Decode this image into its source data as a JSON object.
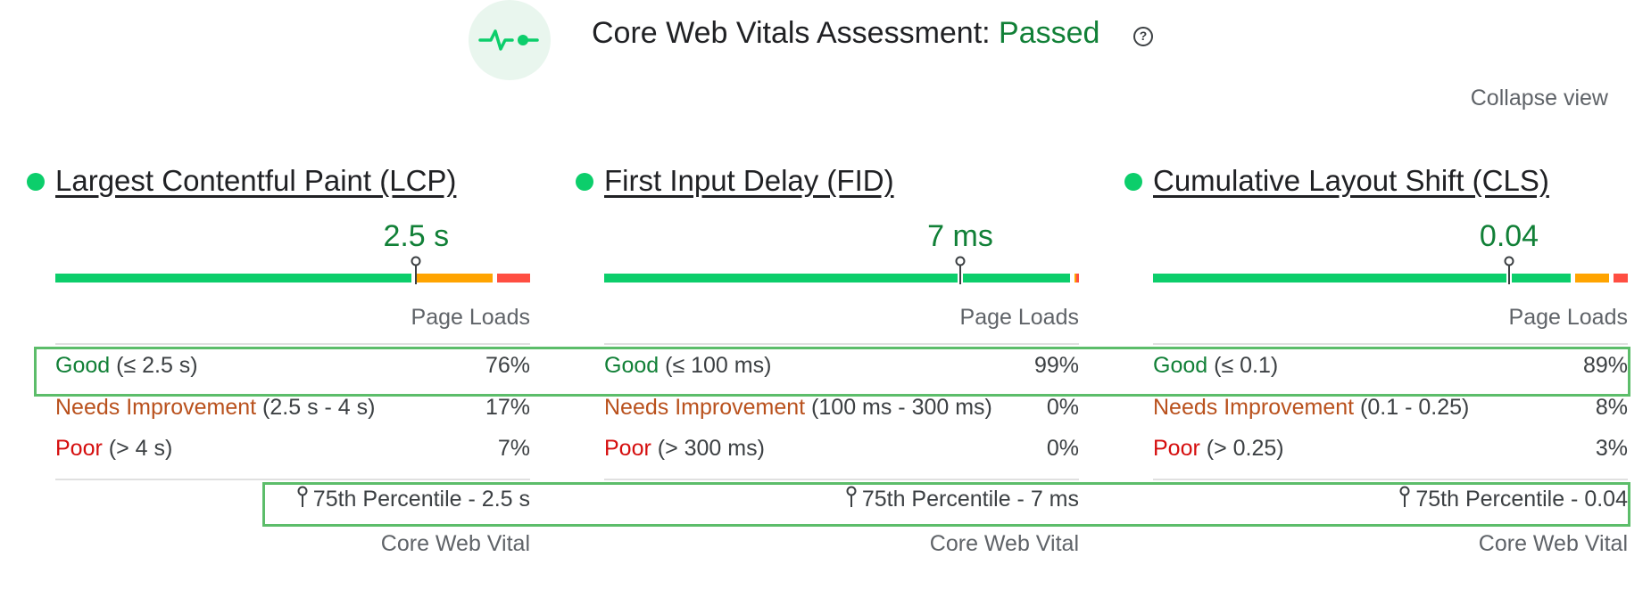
{
  "header": {
    "title_prefix": "Core Web Vitals Assessment: ",
    "status": "Passed",
    "icon": "vitals-pulse-icon",
    "help_icon": "help-circle-icon",
    "help_glyph": "?"
  },
  "collapse_label": "Collapse view",
  "colors": {
    "good": "#0cce6b",
    "good_text": "#118037",
    "needs_improvement": "#ffa400",
    "needs_improvement_text": "#b9511d",
    "poor": "#ff4e42",
    "poor_text": "#d50e0e",
    "highlight_border": "#5cbd6a"
  },
  "metrics": [
    {
      "name": "Largest Contentful Paint (LCP)",
      "p75_value": "2.5 s",
      "page_loads_label": "Page Loads",
      "distribution": {
        "good": 0.76,
        "needs_improvement": 0.17,
        "poor": 0.07
      },
      "p75_position": 0.76,
      "rows": [
        {
          "label": "Good",
          "range": " (≤ 2.5 s)",
          "pct": "76%"
        },
        {
          "label": "Needs Improvement",
          "range": " (2.5 s - 4 s)",
          "pct": "17%"
        },
        {
          "label": "Poor",
          "range": " (> 4 s)",
          "pct": "7%"
        }
      ],
      "p75_label": "75th Percentile - 2.5 s",
      "footer": "Core Web Vital"
    },
    {
      "name": "First Input Delay (FID)",
      "p75_value": "7 ms",
      "page_loads_label": "Page Loads",
      "distribution": {
        "good": 0.99,
        "needs_improvement": 0.005,
        "poor": 0.005
      },
      "p75_position": 0.75,
      "rows": [
        {
          "label": "Good",
          "range": " (≤ 100 ms)",
          "pct": "99%"
        },
        {
          "label": "Needs Improvement",
          "range": " (100 ms - 300 ms)",
          "pct": "0%"
        },
        {
          "label": "Poor",
          "range": " (> 300 ms)",
          "pct": "0%"
        }
      ],
      "p75_label": "75th Percentile - 7 ms",
      "footer": "Core Web Vital"
    },
    {
      "name": "Cumulative Layout Shift (CLS)",
      "p75_value": "0.04",
      "page_loads_label": "Page Loads",
      "distribution": {
        "good": 0.89,
        "needs_improvement": 0.08,
        "poor": 0.03
      },
      "p75_position": 0.75,
      "rows": [
        {
          "label": "Good",
          "range": " (≤ 0.1)",
          "pct": "89%"
        },
        {
          "label": "Needs Improvement",
          "range": " (0.1 - 0.25)",
          "pct": "8%"
        },
        {
          "label": "Poor",
          "range": " (> 0.25)",
          "pct": "3%"
        }
      ],
      "p75_label": "75th Percentile - 0.04",
      "footer": "Core Web Vital"
    }
  ]
}
